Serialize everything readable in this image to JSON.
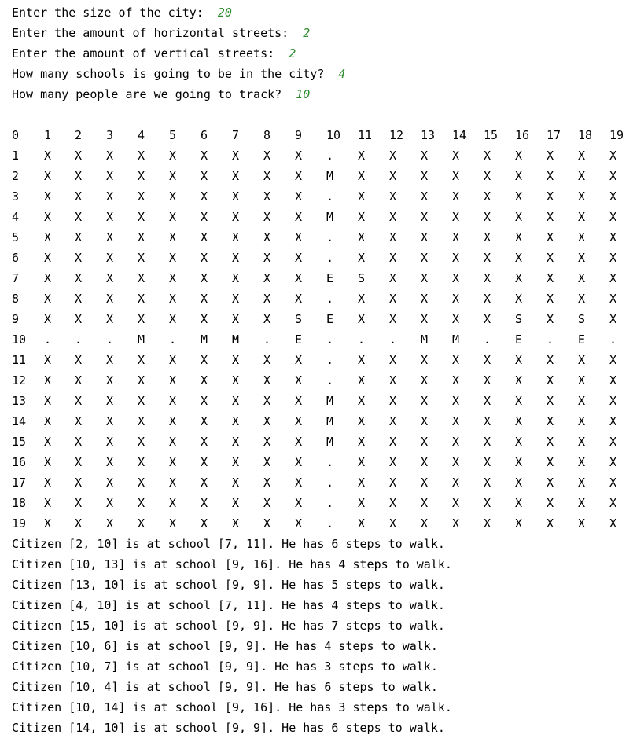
{
  "colors": {
    "background": "#ffffff",
    "text": "#000000",
    "user_input": "#2e8b2e"
  },
  "prompts": [
    {
      "label": "Enter the size of the city:",
      "value": "20"
    },
    {
      "label": "Enter the amount of horizontal streets:",
      "value": "2"
    },
    {
      "label": "Enter the amount of vertical streets:",
      "value": "2"
    },
    {
      "label": "How many schools is going to be in the city?",
      "value": "4"
    },
    {
      "label": "How many people are we going to track?",
      "value": "10"
    }
  ],
  "grid": {
    "header": [
      "0",
      "1",
      "2",
      "3",
      "4",
      "5",
      "6",
      "7",
      "8",
      "9",
      "10",
      "11",
      "12",
      "13",
      "14",
      "15",
      "16",
      "17",
      "18",
      "19"
    ],
    "rows": [
      [
        "1",
        "X",
        "X",
        "X",
        "X",
        "X",
        "X",
        "X",
        "X",
        "X",
        ".",
        "X",
        "X",
        "X",
        "X",
        "X",
        "X",
        "X",
        "X",
        "X"
      ],
      [
        "2",
        "X",
        "X",
        "X",
        "X",
        "X",
        "X",
        "X",
        "X",
        "X",
        "M",
        "X",
        "X",
        "X",
        "X",
        "X",
        "X",
        "X",
        "X",
        "X"
      ],
      [
        "3",
        "X",
        "X",
        "X",
        "X",
        "X",
        "X",
        "X",
        "X",
        "X",
        ".",
        "X",
        "X",
        "X",
        "X",
        "X",
        "X",
        "X",
        "X",
        "X"
      ],
      [
        "4",
        "X",
        "X",
        "X",
        "X",
        "X",
        "X",
        "X",
        "X",
        "X",
        "M",
        "X",
        "X",
        "X",
        "X",
        "X",
        "X",
        "X",
        "X",
        "X"
      ],
      [
        "5",
        "X",
        "X",
        "X",
        "X",
        "X",
        "X",
        "X",
        "X",
        "X",
        ".",
        "X",
        "X",
        "X",
        "X",
        "X",
        "X",
        "X",
        "X",
        "X"
      ],
      [
        "6",
        "X",
        "X",
        "X",
        "X",
        "X",
        "X",
        "X",
        "X",
        "X",
        ".",
        "X",
        "X",
        "X",
        "X",
        "X",
        "X",
        "X",
        "X",
        "X"
      ],
      [
        "7",
        "X",
        "X",
        "X",
        "X",
        "X",
        "X",
        "X",
        "X",
        "X",
        "E",
        "S",
        "X",
        "X",
        "X",
        "X",
        "X",
        "X",
        "X",
        "X"
      ],
      [
        "8",
        "X",
        "X",
        "X",
        "X",
        "X",
        "X",
        "X",
        "X",
        "X",
        ".",
        "X",
        "X",
        "X",
        "X",
        "X",
        "X",
        "X",
        "X",
        "X"
      ],
      [
        "9",
        "X",
        "X",
        "X",
        "X",
        "X",
        "X",
        "X",
        "X",
        "S",
        "E",
        "X",
        "X",
        "X",
        "X",
        "X",
        "S",
        "X",
        "S",
        "X"
      ],
      [
        "10",
        ".",
        ".",
        ".",
        "M",
        ".",
        "M",
        "M",
        ".",
        "E",
        ".",
        ".",
        ".",
        "M",
        "M",
        ".",
        "E",
        ".",
        "E",
        "."
      ],
      [
        "11",
        "X",
        "X",
        "X",
        "X",
        "X",
        "X",
        "X",
        "X",
        "X",
        ".",
        "X",
        "X",
        "X",
        "X",
        "X",
        "X",
        "X",
        "X",
        "X"
      ],
      [
        "12",
        "X",
        "X",
        "X",
        "X",
        "X",
        "X",
        "X",
        "X",
        "X",
        ".",
        "X",
        "X",
        "X",
        "X",
        "X",
        "X",
        "X",
        "X",
        "X"
      ],
      [
        "13",
        "X",
        "X",
        "X",
        "X",
        "X",
        "X",
        "X",
        "X",
        "X",
        "M",
        "X",
        "X",
        "X",
        "X",
        "X",
        "X",
        "X",
        "X",
        "X"
      ],
      [
        "14",
        "X",
        "X",
        "X",
        "X",
        "X",
        "X",
        "X",
        "X",
        "X",
        "M",
        "X",
        "X",
        "X",
        "X",
        "X",
        "X",
        "X",
        "X",
        "X"
      ],
      [
        "15",
        "X",
        "X",
        "X",
        "X",
        "X",
        "X",
        "X",
        "X",
        "X",
        "M",
        "X",
        "X",
        "X",
        "X",
        "X",
        "X",
        "X",
        "X",
        "X"
      ],
      [
        "16",
        "X",
        "X",
        "X",
        "X",
        "X",
        "X",
        "X",
        "X",
        "X",
        ".",
        "X",
        "X",
        "X",
        "X",
        "X",
        "X",
        "X",
        "X",
        "X"
      ],
      [
        "17",
        "X",
        "X",
        "X",
        "X",
        "X",
        "X",
        "X",
        "X",
        "X",
        ".",
        "X",
        "X",
        "X",
        "X",
        "X",
        "X",
        "X",
        "X",
        "X"
      ],
      [
        "18",
        "X",
        "X",
        "X",
        "X",
        "X",
        "X",
        "X",
        "X",
        "X",
        ".",
        "X",
        "X",
        "X",
        "X",
        "X",
        "X",
        "X",
        "X",
        "X"
      ],
      [
        "19",
        "X",
        "X",
        "X",
        "X",
        "X",
        "X",
        "X",
        "X",
        "X",
        ".",
        "X",
        "X",
        "X",
        "X",
        "X",
        "X",
        "X",
        "X",
        "X"
      ]
    ]
  },
  "results": [
    "Citizen [2, 10] is at school [7, 11]. He has 6 steps to walk.",
    "Citizen [10, 13] is at school [9, 16]. He has 4 steps to walk.",
    "Citizen [13, 10] is at school [9, 9]. He has 5 steps to walk.",
    "Citizen [4, 10] is at school [7, 11]. He has 4 steps to walk.",
    "Citizen [15, 10] is at school [9, 9]. He has 7 steps to walk.",
    "Citizen [10, 6] is at school [9, 9]. He has 4 steps to walk.",
    "Citizen [10, 7] is at school [9, 9]. He has 3 steps to walk.",
    "Citizen [10, 4] is at school [9, 9]. He has 6 steps to walk.",
    "Citizen [10, 14] is at school [9, 16]. He has 3 steps to walk.",
    "Citizen [14, 10] is at school [9, 9]. He has 6 steps to walk."
  ]
}
